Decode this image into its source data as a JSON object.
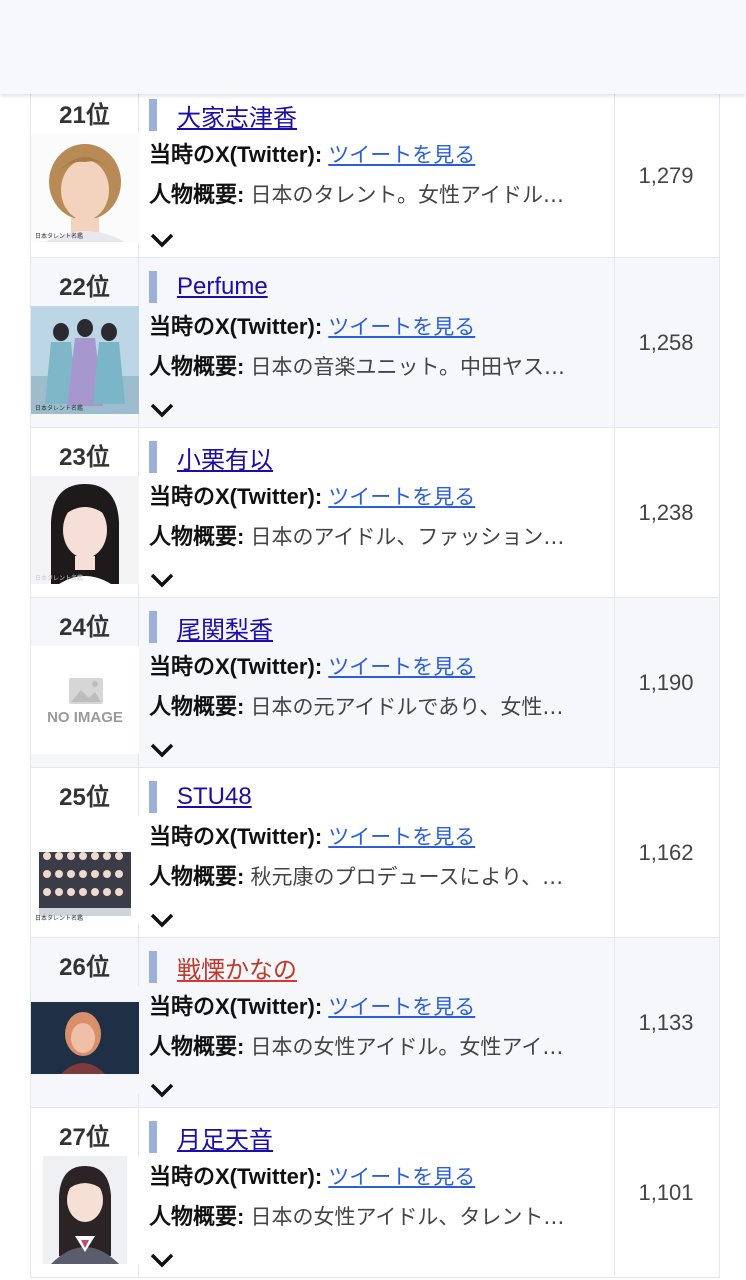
{
  "rows": [
    {
      "rank": "21位",
      "name": "大家志津香",
      "tw_label": "当時のX(Twitter)",
      "tw_link": "ツイートを見る",
      "desc_label": "人物概要",
      "desc": "日本のタレント。女性アイドル…",
      "count": "1,279",
      "thumb": "portrait-short-hair",
      "watermark": "日本タレント名鑑"
    },
    {
      "rank": "22位",
      "name": "Perfume",
      "tw_label": "当時のX(Twitter)",
      "tw_link": "ツイートを見る",
      "desc_label": "人物概要",
      "desc": "日本の音楽ユニット。中田ヤス…",
      "count": "1,258",
      "thumb": "trio-group",
      "watermark": "日本タレント名鑑"
    },
    {
      "rank": "23位",
      "name": "小栗有以",
      "tw_label": "当時のX(Twitter)",
      "tw_link": "ツイートを見る",
      "desc_label": "人物概要",
      "desc": "日本のアイドル、ファッション…",
      "count": "1,238",
      "thumb": "portrait-long-hair",
      "watermark": "日本タレント名鑑"
    },
    {
      "rank": "24位",
      "name": "尾関梨香",
      "tw_label": "当時のX(Twitter)",
      "tw_link": "ツイートを見る",
      "desc_label": "人物概要",
      "desc": "日本の元アイドルであり、女性…",
      "count": "1,190",
      "thumb": "no-image",
      "no_image_text": "NO IMAGE"
    },
    {
      "rank": "25位",
      "name": "STU48",
      "tw_label": "当時のX(Twitter)",
      "tw_link": "ツイートを見る",
      "desc_label": "人物概要",
      "desc": "秋元康のプロデュースにより、…",
      "count": "1,162",
      "thumb": "large-group",
      "watermark": "日本タレント名鑑"
    },
    {
      "rank": "26位",
      "name": "戦慄かなの",
      "tw_label": "当時のX(Twitter)",
      "tw_link": "ツイートを見る",
      "desc_label": "人物概要",
      "desc": "日本の女性アイドル。女性アイ…",
      "count": "1,133",
      "thumb": "dark-portrait"
    },
    {
      "rank": "27位",
      "name": "月足天音",
      "tw_label": "当時のX(Twitter)",
      "tw_link": "ツイートを見る",
      "desc_label": "人物概要",
      "desc": "日本の女性アイドル、タレント…",
      "count": "1,101",
      "thumb": "idol-uniform"
    }
  ],
  "colors": {
    "link": "#1a0dab",
    "accent_bar": "#9db0d8",
    "shade": "#f5f7fa"
  }
}
